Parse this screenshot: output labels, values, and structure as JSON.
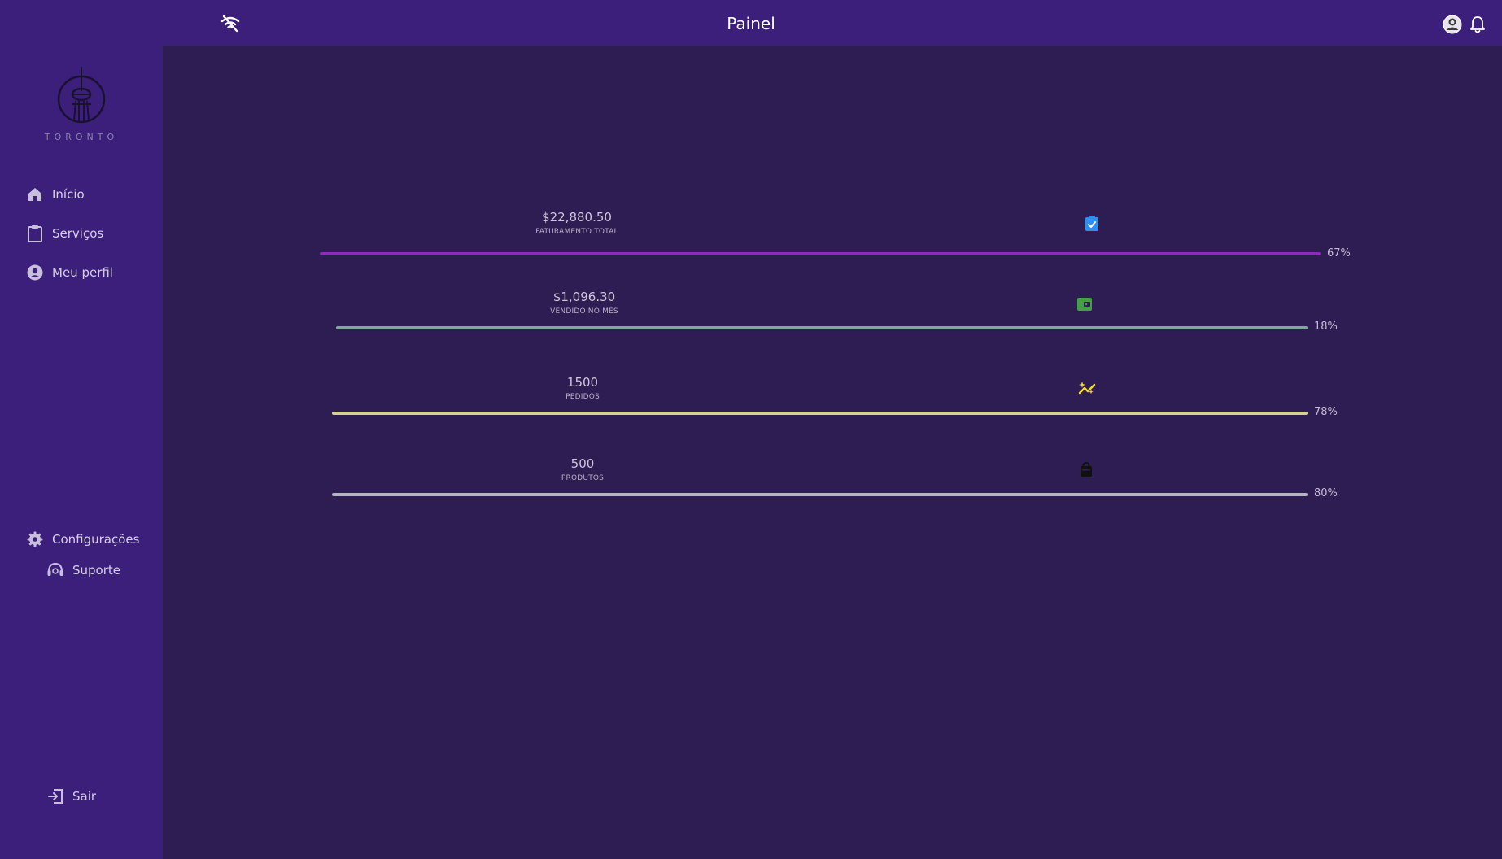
{
  "header": {
    "title": "Painel",
    "icons": [
      "wifi-off-icon",
      "avatar-icon",
      "bell-icon"
    ]
  },
  "sidebar": {
    "logo_text": "TORONTO",
    "nav": [
      {
        "label": "Início",
        "icon": "home-icon"
      },
      {
        "label": "Serviços",
        "icon": "clipboard-icon"
      },
      {
        "label": "Meu perfil",
        "icon": "user-circle-icon"
      }
    ],
    "settings": {
      "label": "Configurações",
      "icon": "gear-icon"
    },
    "support": {
      "label": "Suporte",
      "icon": "headset-icon"
    },
    "logout": {
      "label": "Sair",
      "icon": "logout-icon"
    }
  },
  "stats": [
    {
      "value": "$22,880.50",
      "label": "FATURAMENTO TOTAL",
      "percent_text": "67%",
      "progress": 0.67,
      "color": "#8b2db8",
      "icon": "clipboard-check-icon",
      "icon_color": "#2f8ff0"
    },
    {
      "value": "$1,096.30",
      "label": "VENDIDO NO MÊS",
      "percent_text": "18%",
      "progress": 0.18,
      "color": "#7fa79a",
      "icon": "wallet-icon",
      "icon_color": "#43a047"
    },
    {
      "value": "1500",
      "label": "PEDIDOS",
      "percent_text": "78%",
      "progress": 0.78,
      "color": "#d8cf92",
      "icon": "sparkle-trend-icon",
      "icon_color": "#f2d93b"
    },
    {
      "value": "500",
      "label": "PRODUTOS",
      "percent_text": "80%",
      "progress": 0.8,
      "color": "#b6b3c2",
      "icon": "shopping-bag-icon",
      "icon_color": "#111111"
    }
  ]
}
